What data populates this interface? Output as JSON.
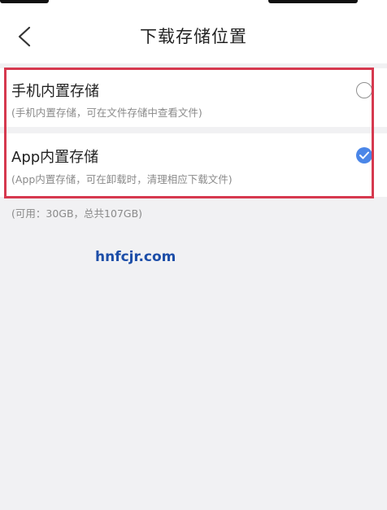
{
  "header": {
    "title": "下载存储位置",
    "back_icon": "chevron-left-icon"
  },
  "options": [
    {
      "title": "手机内置存储",
      "description": "(手机内置存储，可在文件存储中查看文件)",
      "selected": false
    },
    {
      "title": "App内置存储",
      "description": "(App内置存储，可在卸载时，清理相应下载文件)",
      "selected": true
    }
  ],
  "storage_info": "(可用：30GB，总共107GB)",
  "watermark": "hnfcjr.com",
  "colors": {
    "accent": "#4a86e8",
    "highlight": "#d6394f",
    "background": "#f1f1f3",
    "watermark": "#1d4ea8"
  }
}
